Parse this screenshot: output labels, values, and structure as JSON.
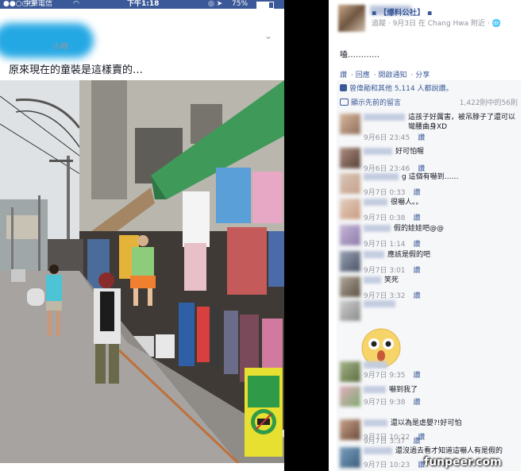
{
  "status_bar": {
    "signal": "●●○○○",
    "carrier": "中華電信",
    "time": "下午1:18",
    "battery_pct": "75%",
    "battery_level": 0.75
  },
  "post_left": {
    "meta": "小時 ·",
    "text": "原來現在的童裝是這樣賣的…"
  },
  "post_right": {
    "page_name": "▪ 【爆料公社】 ▪",
    "time": "追蹤 · 9月3日 在 Chang Hwa 附近 · 🌐",
    "content": "嗑…………",
    "actions": [
      "讚",
      "回應",
      "開啟通知",
      "分享"
    ],
    "likes": {
      "prefix": "",
      "text": "曾偉勛和其他 5,114 人都說讚。"
    },
    "previous": {
      "label": "顯示先前的留言",
      "count": "1,422則中的56則"
    },
    "reply_label": "讚",
    "comments": [
      {
        "text": "這孩子好厲害，被吊脖子了還可以彎腰曲身XD",
        "time": "9月6日 23:45"
      },
      {
        "text": "好可怕喔",
        "time": "9月6日 23:46"
      },
      {
        "text": "g 這個有嚇到……",
        "time": "9月7日 0:33"
      },
      {
        "text": "很嚇人。。",
        "time": "9月7日 0:38"
      },
      {
        "text": "假的娃娃吧@@",
        "time": "9月7日 1:14"
      },
      {
        "text": "應該是假的吧",
        "time": "9月7日 3:01"
      },
      {
        "text": "笑死",
        "time": "9月7日 3:32"
      },
      {
        "text": "",
        "time": "9月7日 3:37"
      },
      {
        "text": "",
        "time": "9月7日 9:35"
      },
      {
        "text": "嚇到我了",
        "time": "9月7日 9:38"
      },
      {
        "text": "還以為是虐嬰?!好可怕",
        "time": "9月7日 10:22"
      },
      {
        "text": "還沒過去看才知道這嚇人有是假的",
        "time": "9月7日 10:23"
      }
    ]
  },
  "watermark": "funpeer.com",
  "colors": {
    "fb_blue": "#3b5998",
    "link": "#3b5998",
    "meta_gray": "#90949c",
    "awning_green": "#3f9a5a",
    "sign_yellow": "#e8e030"
  }
}
